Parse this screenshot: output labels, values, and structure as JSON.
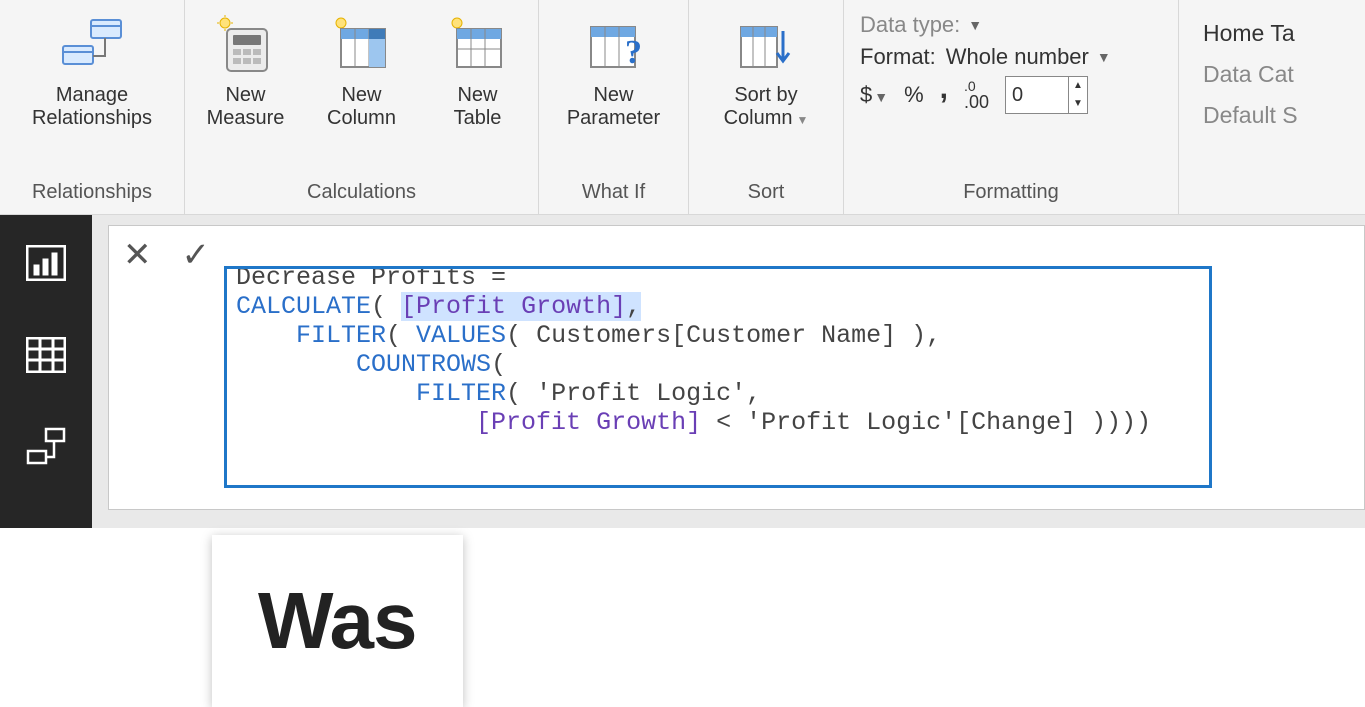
{
  "ribbon": {
    "groups": {
      "relationships": {
        "label": "Relationships",
        "manage": "Manage\nRelationships"
      },
      "calculations": {
        "label": "Calculations",
        "measure": "New\nMeasure",
        "column": "New\nColumn",
        "table": "New\nTable"
      },
      "whatif": {
        "label": "What If",
        "param": "New\nParameter"
      },
      "sort": {
        "label": "Sort",
        "sortby": "Sort by\nColumn"
      },
      "formatting": {
        "label": "Formatting",
        "datatype_label": "Data type:",
        "format_label": "Format:",
        "format_value": "Whole number",
        "currency_sym": "$",
        "percent_sym": "%",
        "thousands_sym": ",",
        "decimal_sym": ".00",
        "decimal_toggle_sym": ".0",
        "decimals": "0"
      },
      "properties": {
        "home_table": "Home Ta",
        "data_category": "Data Cat",
        "default_summarization": "Default S"
      }
    }
  },
  "formula": {
    "line1_a": "Decrease Profits = ",
    "calc": "CALCULATE",
    "open1": "( ",
    "profit_growth": "[Profit Growth]",
    "comma1": ",",
    "indent1": "    ",
    "filter": "FILTER",
    "open2": "( ",
    "values": "VALUES",
    "open3": "( ",
    "cust": "Customers[Customer Name] ),",
    "indent2": "        ",
    "countrows": "COUNTROWS",
    "open4": "(",
    "indent3": "            ",
    "filter2": "FILTER",
    "open5": "( ",
    "profit_logic": "'Profit Logic',",
    "indent4": "                ",
    "pg2": "[Profit Growth]",
    "lt": " < ",
    "change_col": "'Profit Logic'[Change] ))))"
  },
  "page": {
    "heading_partial": "Was"
  }
}
